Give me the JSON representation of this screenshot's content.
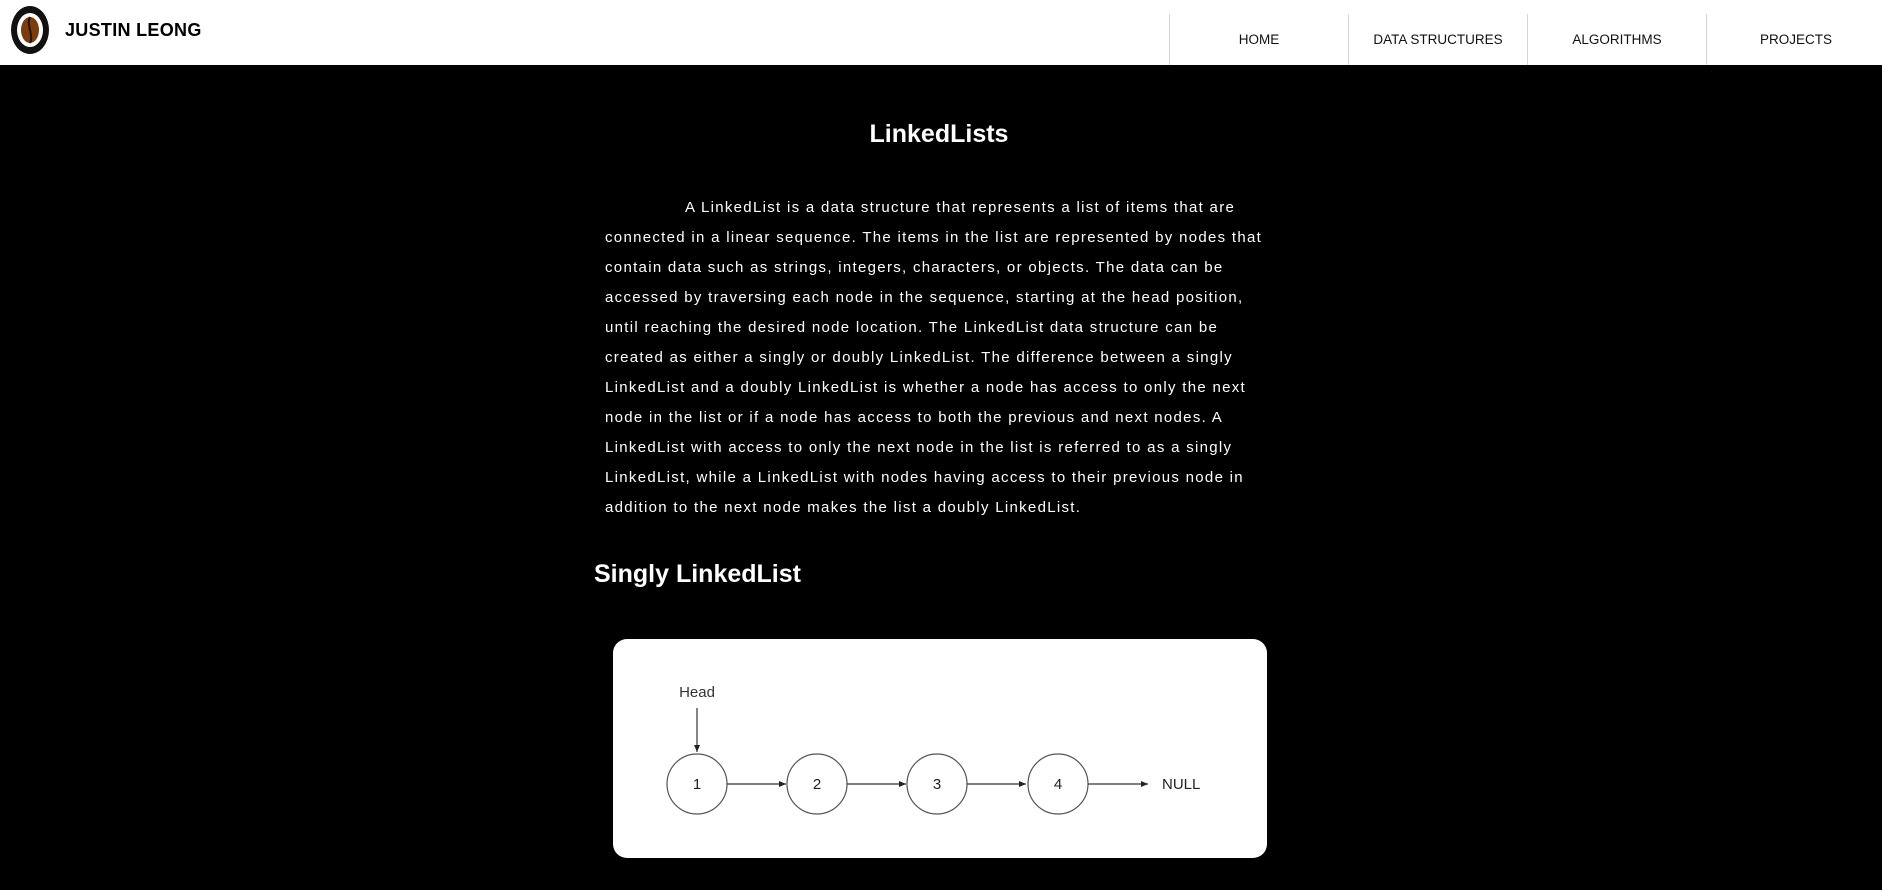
{
  "header": {
    "brand": "JUSTIN LEONG",
    "logo_icon": "coffee-bean-logo-icon",
    "nav": [
      "HOME",
      "DATA STRUCTURES",
      "ALGORITHMS",
      "PROJECTS"
    ]
  },
  "page": {
    "title": "LinkedLists",
    "intro": "A LinkedList is a data structure that represents a list of items that are connected in a linear sequence. The items in the list are represented by nodes that contain data such as strings, integers, characters, or objects. The data can be accessed by traversing each node in the sequence, starting at the head position, until reaching the desired node location. The LinkedList data structure can be created as either a singly or doubly LinkedList. The difference between a singly LinkedList and a doubly LinkedList is whether a node has access to only the next node in the list or if a node has access to both the previous and next nodes. A LinkedList with access to only the next node in the list is referred to as a singly LinkedList, while a LinkedList with nodes having access to their previous node in addition to the next node makes the list a doubly LinkedList.",
    "section_title": "Singly LinkedList"
  },
  "diagram": {
    "head_label": "Head",
    "nodes": [
      "1",
      "2",
      "3",
      "4"
    ],
    "terminal": "NULL"
  },
  "colors": {
    "background": "#000000",
    "header": "#ffffff",
    "text": "#ffffff",
    "logo_bean": "#7a3d12"
  }
}
